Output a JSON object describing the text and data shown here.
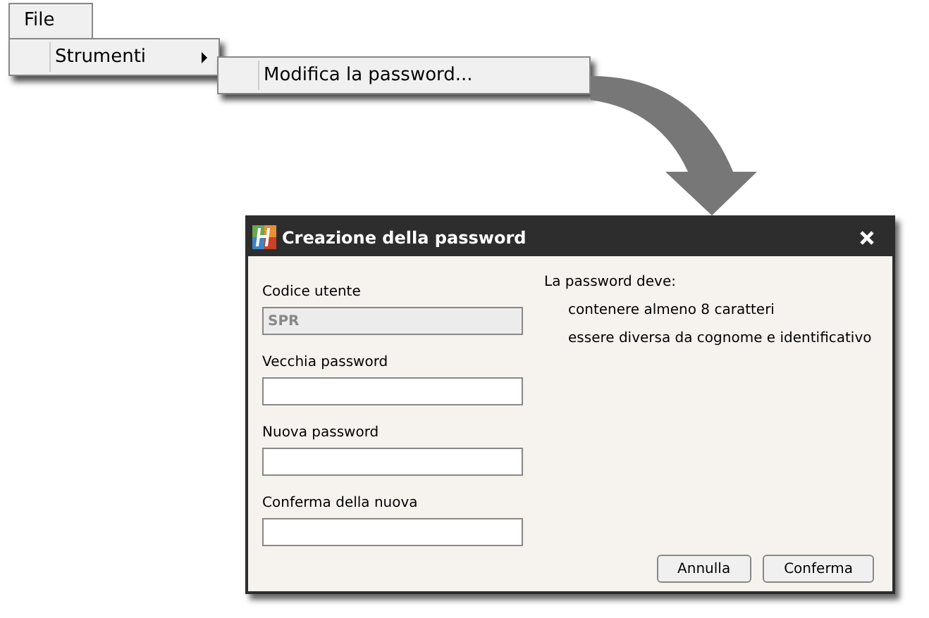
{
  "menu_bar": [
    {
      "label": "File"
    }
  ],
  "menu": [
    {
      "label": "Strumenti",
      "has_submenu": true
    }
  ],
  "submenu": [
    {
      "label": "Modifica la password..."
    }
  ],
  "dialog": {
    "title": "Creazione della password",
    "fields": [
      {
        "label": "Codice utente",
        "value": "SPR",
        "disabled": true
      },
      {
        "label": "Vecchia password",
        "disabled": false
      },
      {
        "label": "Nuova password",
        "disabled": false
      },
      {
        "label": "Conferma della nuova",
        "disabled": false
      }
    ],
    "rules": {
      "heading": "La password deve:",
      "items": [
        "contenere almeno 8 caratteri",
        "essere diversa da cognome e identificativo"
      ]
    },
    "buttons": [
      "Annulla",
      "Conferma"
    ]
  }
}
